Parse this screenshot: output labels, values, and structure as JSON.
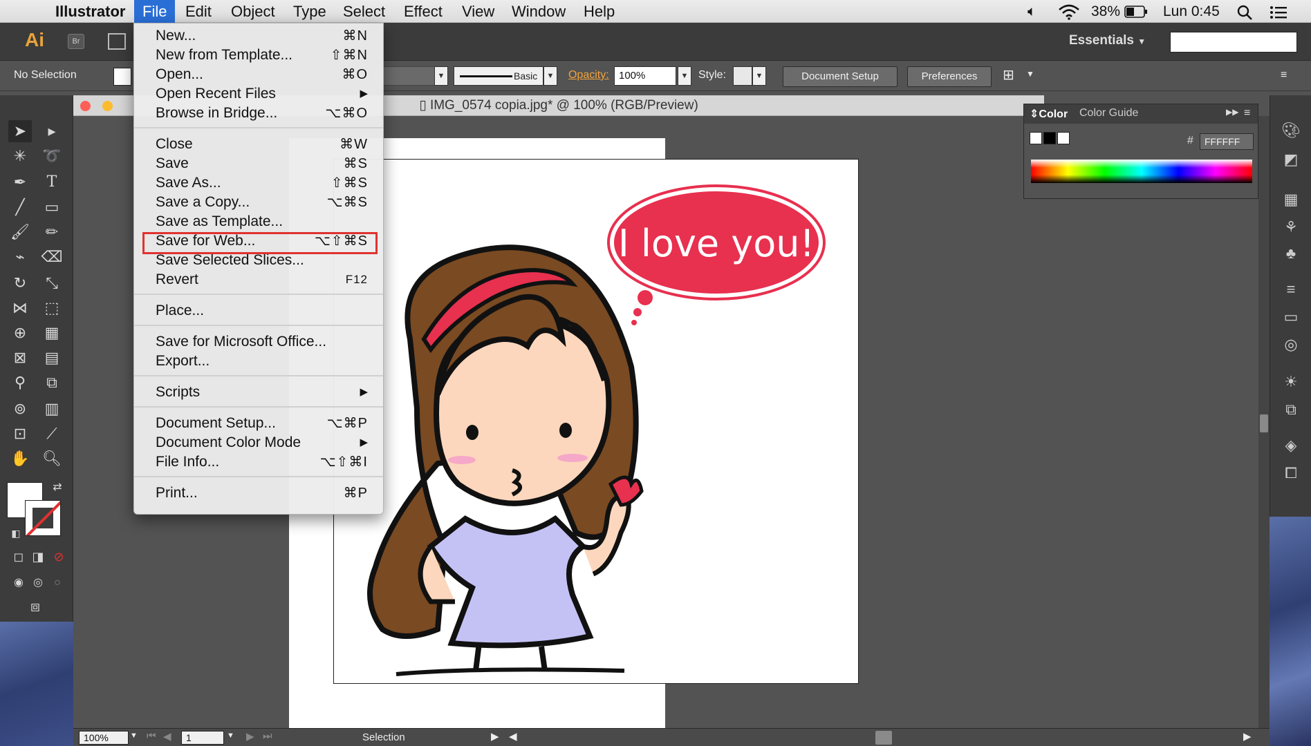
{
  "menubar": {
    "app_name": "Illustrator",
    "menus": [
      "File",
      "Edit",
      "Object",
      "Type",
      "Select",
      "Effect",
      "View",
      "Window",
      "Help"
    ],
    "battery": "38%",
    "clock": "Lun 0:45"
  },
  "appbar": {
    "logo": "Ai",
    "bridge": "Br",
    "workspace": "Essentials"
  },
  "optionsbar": {
    "selection_label": "No Selection",
    "brush_label": "Basic",
    "opacity_label": "Opacity:",
    "opacity_value": "100%",
    "style_label": "Style:",
    "document_setup": "Document Setup",
    "preferences": "Preferences"
  },
  "document": {
    "title": "IMG_0574 copia.jpg* @ 100% (RGB/Preview)"
  },
  "color_panel": {
    "tabs": [
      "Color",
      "Color Guide"
    ],
    "hex_prefix": "#",
    "hex_value": "FFFFFF"
  },
  "file_menu": {
    "items": [
      {
        "label": "New...",
        "shortcut": "⌘N"
      },
      {
        "label": "New from Template...",
        "shortcut": "⇧⌘N"
      },
      {
        "label": "Open...",
        "shortcut": "⌘O"
      },
      {
        "label": "Open Recent Files",
        "submenu": "▶"
      },
      {
        "label": "Browse in Bridge...",
        "shortcut": "⌥⌘O"
      },
      {
        "label": "Close",
        "shortcut": "⌘W"
      },
      {
        "label": "Save",
        "shortcut": "⌘S"
      },
      {
        "label": "Save As...",
        "shortcut": "⇧⌘S"
      },
      {
        "label": "Save a Copy...",
        "shortcut": "⌥⌘S"
      },
      {
        "label": "Save as Template..."
      },
      {
        "label": "Save for Web...",
        "shortcut": "⌥⇧⌘S"
      },
      {
        "label": "Save Selected Slices..."
      },
      {
        "label": "Revert",
        "shortcut": "F12"
      },
      {
        "label": "Place..."
      },
      {
        "label": "Save for Microsoft Office..."
      },
      {
        "label": "Export..."
      },
      {
        "label": "Scripts",
        "submenu": "▶"
      },
      {
        "label": "Document Setup...",
        "shortcut": "⌥⌘P"
      },
      {
        "label": "Document Color Mode",
        "submenu": "▶"
      },
      {
        "label": "File Info...",
        "shortcut": "⌥⇧⌘I"
      },
      {
        "label": "Print...",
        "shortcut": "⌘P"
      }
    ]
  },
  "artwork": {
    "bubble_text": "I love you!",
    "colors": {
      "hair": "#7a4a22",
      "headband": "#e8304f",
      "skin": "#fcd7bd",
      "dress": "#c4c2f5",
      "bubble": "#e8304f"
    }
  },
  "statusbar": {
    "zoom": "100%",
    "page": "1",
    "tool": "Selection"
  },
  "accent": {
    "menu_highlight": "#2a6fd6",
    "callout": "#e0322f",
    "ai_orange": "#e8a33a"
  }
}
